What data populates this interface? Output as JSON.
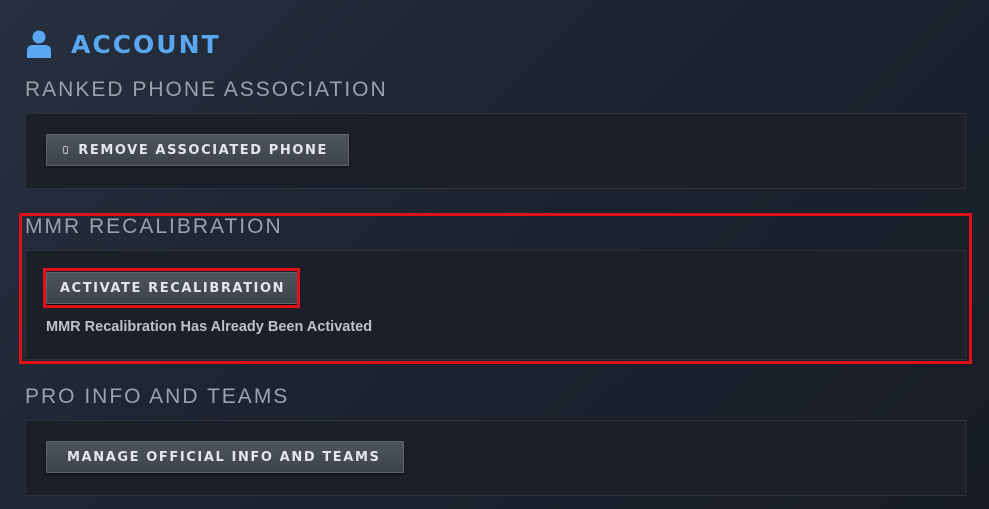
{
  "header": {
    "icon": "user-icon",
    "title": "ACCOUNT"
  },
  "sections": {
    "ranked_phone": {
      "title": "RANKED PHONE ASSOCIATION",
      "button_label": "REMOVE ASSOCIATED PHONE",
      "button_icon": "phone-icon"
    },
    "mmr": {
      "title": "MMR RECALIBRATION",
      "button_label": "ACTIVATE RECALIBRATION",
      "status": "MMR Recalibration Has Already Been Activated"
    },
    "pro": {
      "title": "PRO INFO AND TEAMS",
      "button_label": "MANAGE OFFICIAL INFO AND TEAMS",
      "button_icon": "external-link-arrow-icon"
    }
  },
  "colors": {
    "accent": "#5aa6f0",
    "highlight": "#e01018",
    "section_title": "#9aa2ad"
  }
}
